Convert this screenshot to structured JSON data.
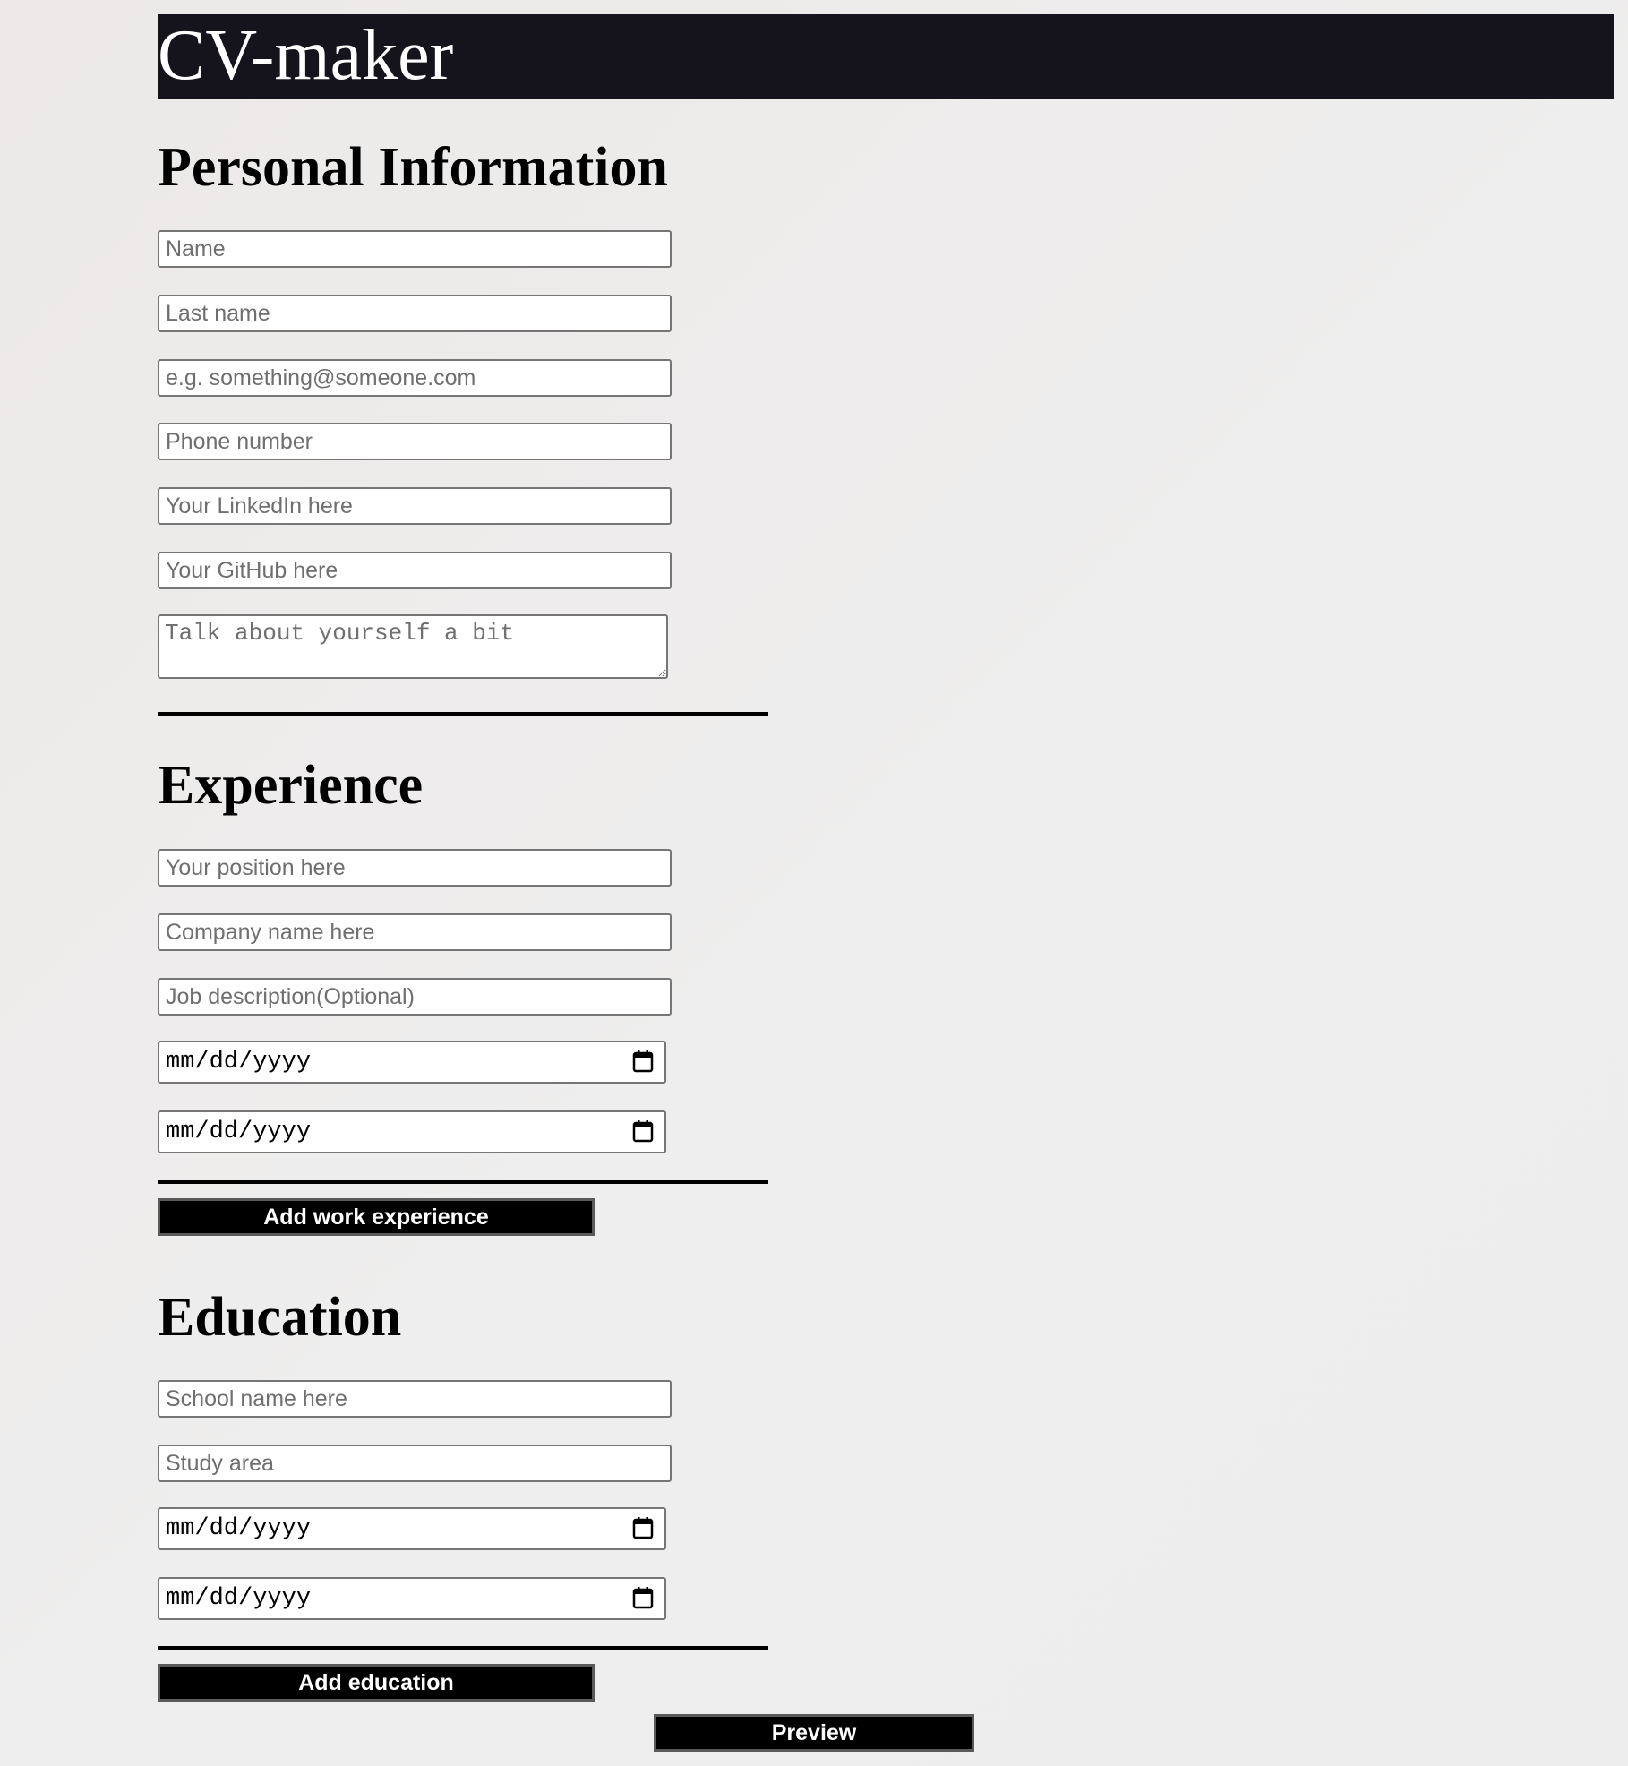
{
  "header": {
    "title": "CV-maker"
  },
  "personal": {
    "heading": "Personal Information",
    "name_placeholder": "Name",
    "last_name_placeholder": "Last name",
    "email_placeholder": "e.g. something@someone.com",
    "phone_placeholder": "Phone number",
    "linkedin_placeholder": "Your LinkedIn here",
    "github_placeholder": "Your GitHub here",
    "about_placeholder": "Talk about yourself a bit"
  },
  "experience": {
    "heading": "Experience",
    "position_placeholder": "Your position here",
    "company_placeholder": "Company name here",
    "description_placeholder": "Job description(Optional)",
    "start_date_text": "mm/dd/yyyy",
    "end_date_text": "mm/dd/yyyy",
    "add_button_label": "Add work experience"
  },
  "education": {
    "heading": "Education",
    "school_placeholder": "School name here",
    "study_area_placeholder": "Study area",
    "start_date_text": "mm/dd/yyyy",
    "end_date_text": "mm/dd/yyyy",
    "add_button_label": "Add education"
  },
  "preview_button_label": "Preview",
  "colors": {
    "header_background": "#15131c",
    "button_background": "#000000",
    "page_background": "#eeedee"
  },
  "icons": {
    "date_picker": "calendar-icon"
  }
}
